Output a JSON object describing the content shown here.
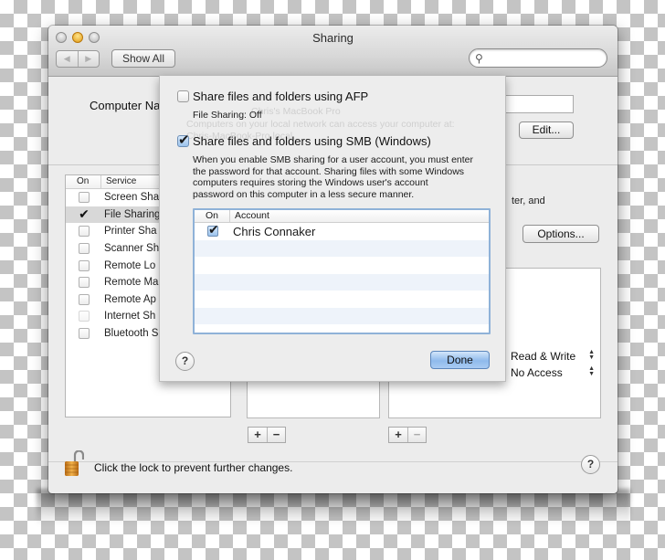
{
  "window": {
    "title": "Sharing",
    "nav_back": "◀",
    "nav_forward": "▶",
    "show_all_label": "Show All",
    "search_placeholder": "",
    "search_icon": "⌕"
  },
  "main": {
    "computer_name_label": "Computer Name:",
    "computer_name_value": "",
    "edit_button": "Edit...",
    "services_header": {
      "on": "On",
      "service": "Service"
    },
    "services": [
      {
        "name": "Screen Sharing",
        "checked": false,
        "selected": false,
        "enabled": true
      },
      {
        "name": "File Sharing",
        "checked": true,
        "selected": true,
        "enabled": true
      },
      {
        "name": "Printer Sharing",
        "checked": false,
        "selected": false,
        "enabled": true
      },
      {
        "name": "Scanner Sharing",
        "checked": false,
        "selected": false,
        "enabled": true
      },
      {
        "name": "Remote Login",
        "checked": false,
        "selected": false,
        "enabled": true
      },
      {
        "name": "Remote Management",
        "checked": false,
        "selected": false,
        "enabled": true
      },
      {
        "name": "Remote Apple Events",
        "checked": false,
        "selected": false,
        "enabled": true
      },
      {
        "name": "Internet Sharing",
        "checked": false,
        "selected": false,
        "enabled": false
      },
      {
        "name": "Bluetooth Sharing",
        "checked": false,
        "selected": false,
        "enabled": true
      }
    ],
    "visible_service_labels": [
      "Screen Sha",
      "File Sharing",
      "Printer Sha",
      "Scanner Sh",
      "Remote Lo",
      "Remote Ma",
      "Remote Ap",
      "Internet Sh",
      "Bluetooth S"
    ],
    "description_tail": "ter, and",
    "options_button": "Options...",
    "permissions": [
      {
        "value": "Read & Write"
      },
      {
        "value": "No Access"
      }
    ],
    "add_symbol": "+",
    "remove_symbol": "−",
    "lock_text": "Click the lock to prevent further changes.",
    "help_symbol": "?"
  },
  "sheet": {
    "afp": {
      "label": "Share files and folders using AFP",
      "checked": false,
      "status": "File Sharing: Off"
    },
    "smb": {
      "label": "Share files and folders using SMB (Windows)",
      "checked": true,
      "note_lines": [
        "When you enable SMB sharing for a user account, you must enter",
        "the password for that account. Sharing files with some Windows",
        "computers requires storing the Windows user's account",
        "password on this computer in a less secure manner."
      ]
    },
    "accounts_header": {
      "on": "On",
      "account": "Account"
    },
    "accounts": [
      {
        "name": "Chris Connaker",
        "checked": true
      }
    ],
    "help_symbol": "?",
    "done_button": "Done",
    "ghost_text": [
      "Chris's MacBook Pro",
      "Computers on your local network can access your computer at:",
      "Chris-MacBook-Pro.local"
    ]
  }
}
